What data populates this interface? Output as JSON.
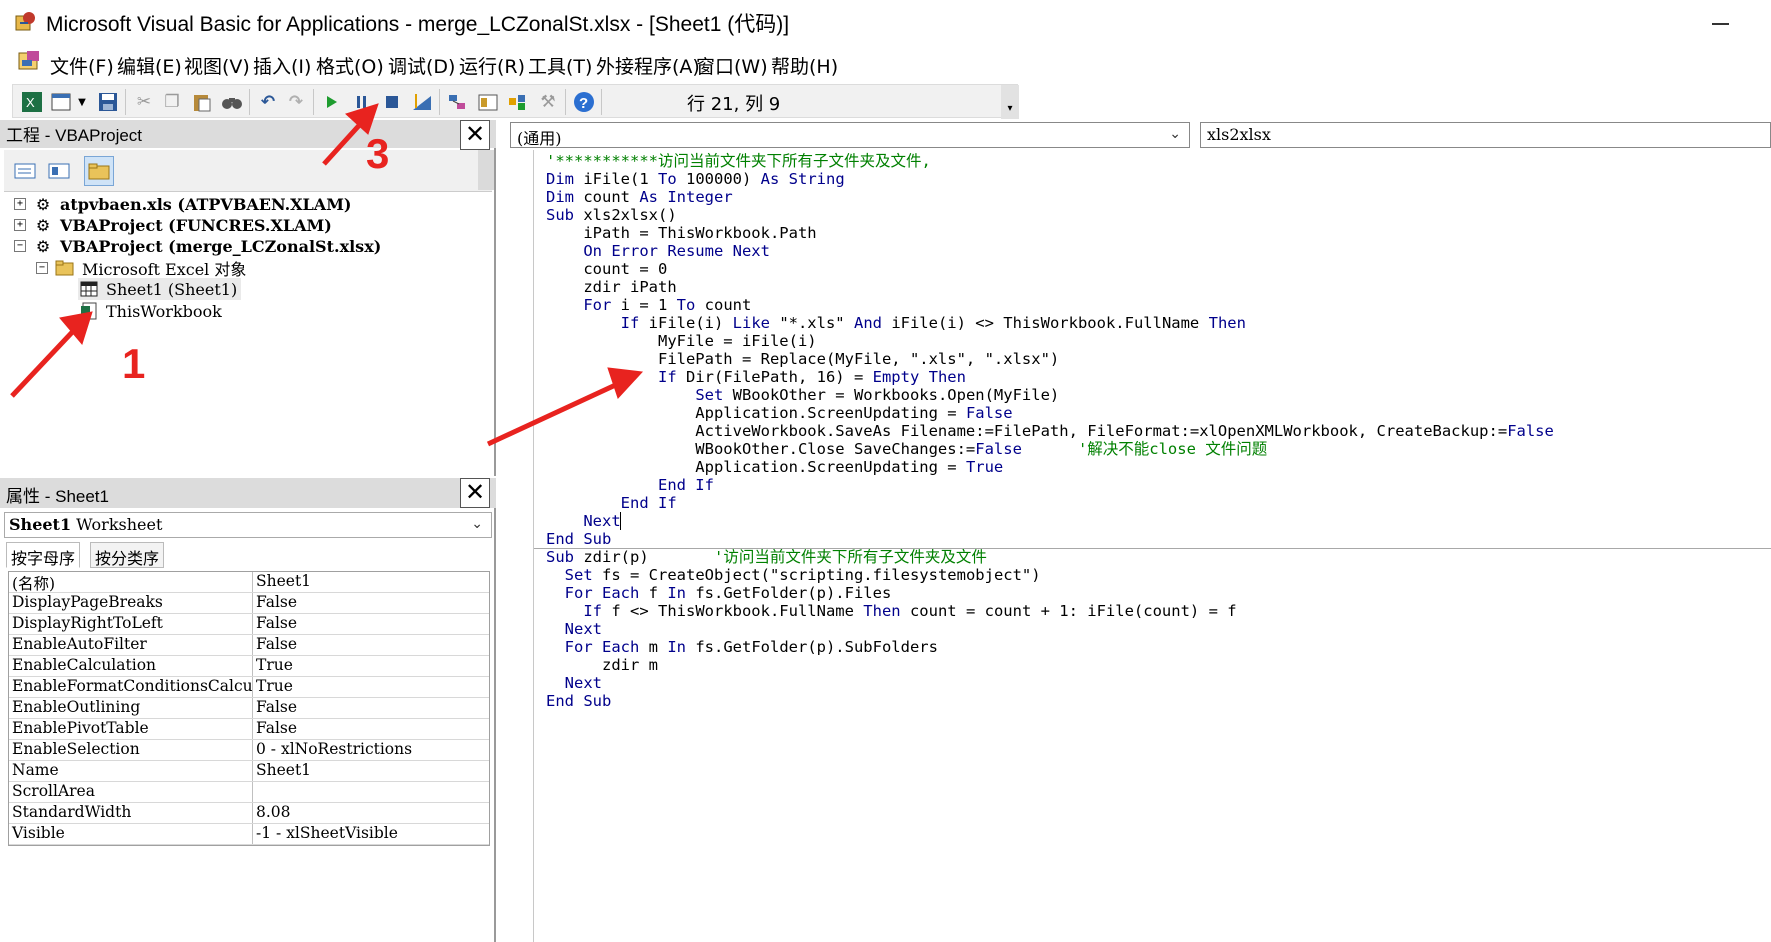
{
  "window": {
    "title": "Microsoft Visual Basic for Applications - merge_LCZonalSt.xlsx - [Sheet1 (代码)]"
  },
  "menu": [
    "文件(F)",
    "编辑(E)",
    "视图(V)",
    "插入(I)",
    "格式(O)",
    "调试(D)",
    "运行(R)",
    "工具(T)",
    "外接程序(A)",
    "窗口(W)",
    "帮助(H)"
  ],
  "toolbar": {
    "position_text": "行 21, 列 9"
  },
  "project": {
    "title": "工程 - VBAProject",
    "items": [
      {
        "label": "atpvbaen.xls (ATPVBAEN.XLAM)"
      },
      {
        "label": "VBAProject (FUNCRES.XLAM)"
      },
      {
        "label": "VBAProject (merge_LCZonalSt.xlsx)"
      },
      {
        "label": "Microsoft Excel 对象"
      },
      {
        "label": "Sheet1 (Sheet1)"
      },
      {
        "label": "ThisWorkbook"
      }
    ]
  },
  "properties": {
    "title": "属性 - Sheet1",
    "object_name": "Sheet1",
    "object_type": "Worksheet",
    "tabs": [
      "按字母序",
      "按分类序"
    ],
    "rows": [
      {
        "name": "(名称)",
        "value": "Sheet1"
      },
      {
        "name": "DisplayPageBreaks",
        "value": "False"
      },
      {
        "name": "DisplayRightToLeft",
        "value": "False"
      },
      {
        "name": "EnableAutoFilter",
        "value": "False"
      },
      {
        "name": "EnableCalculation",
        "value": "True"
      },
      {
        "name": "EnableFormatConditionsCalcu",
        "value": "True"
      },
      {
        "name": "EnableOutlining",
        "value": "False"
      },
      {
        "name": "EnablePivotTable",
        "value": "False"
      },
      {
        "name": "EnableSelection",
        "value": "0 - xlNoRestrictions"
      },
      {
        "name": "Name",
        "value": "Sheet1"
      },
      {
        "name": "ScrollArea",
        "value": ""
      },
      {
        "name": "StandardWidth",
        "value": "8.08"
      },
      {
        "name": "Visible",
        "value": "-1 - xlSheetVisible"
      }
    ]
  },
  "code": {
    "object_combo": "(通用)",
    "proc_combo": "xls2xlsx",
    "lines": [
      [
        {
          "t": "'***********访问当前文件夹下所有子文件夹及文件,",
          "c": "cm"
        }
      ],
      [
        {
          "t": "Dim",
          "c": "kw"
        },
        {
          "t": " iFile(1 "
        },
        {
          "t": "To",
          "c": "kw"
        },
        {
          "t": " 100000) "
        },
        {
          "t": "As String",
          "c": "kw"
        }
      ],
      [
        {
          "t": "Dim",
          "c": "kw"
        },
        {
          "t": " count "
        },
        {
          "t": "As Integer",
          "c": "kw"
        }
      ],
      [
        {
          "t": "Sub",
          "c": "kw"
        },
        {
          "t": " xls2xlsx()"
        }
      ],
      [
        {
          "t": "    iPath = ThisWorkbook.Path"
        }
      ],
      [
        {
          "t": "    "
        },
        {
          "t": "On Error Resume Next",
          "c": "kw"
        }
      ],
      [
        {
          "t": "    count = 0"
        }
      ],
      [
        {
          "t": "    zdir iPath"
        }
      ],
      [
        {
          "t": "    "
        },
        {
          "t": "For",
          "c": "kw"
        },
        {
          "t": " i = 1 "
        },
        {
          "t": "To",
          "c": "kw"
        },
        {
          "t": " count"
        }
      ],
      [
        {
          "t": "        "
        },
        {
          "t": "If",
          "c": "kw"
        },
        {
          "t": " iFile(i) "
        },
        {
          "t": "Like",
          "c": "kw"
        },
        {
          "t": " \"*.xls\" "
        },
        {
          "t": "And",
          "c": "kw"
        },
        {
          "t": " iFile(i) <> ThisWorkbook.FullName "
        },
        {
          "t": "Then",
          "c": "kw"
        }
      ],
      [
        {
          "t": "            MyFile = iFile(i)"
        }
      ],
      [
        {
          "t": "            FilePath = Replace(MyFile, \".xls\", \".xlsx\")"
        }
      ],
      [
        {
          "t": "            "
        },
        {
          "t": "If",
          "c": "kw"
        },
        {
          "t": " Dir(FilePath, 16) = "
        },
        {
          "t": "Empty Then",
          "c": "kw"
        }
      ],
      [
        {
          "t": "                "
        },
        {
          "t": "Set",
          "c": "kw"
        },
        {
          "t": " WBookOther = Workbooks.Open(MyFile)"
        }
      ],
      [
        {
          "t": "                Application.ScreenUpdating = "
        },
        {
          "t": "False",
          "c": "kw"
        }
      ],
      [
        {
          "t": "                ActiveWorkbook.SaveAs Filename:=FilePath, FileFormat:=xlOpenXMLWorkbook, CreateBackup:="
        },
        {
          "t": "False",
          "c": "kw"
        }
      ],
      [
        {
          "t": "                WBookOther.Close SaveChanges:="
        },
        {
          "t": "False",
          "c": "kw"
        },
        {
          "t": "      "
        },
        {
          "t": "'解决不能close 文件问题",
          "c": "cm"
        }
      ],
      [
        {
          "t": "                Application.ScreenUpdating = "
        },
        {
          "t": "True",
          "c": "kw"
        }
      ],
      [
        {
          "t": "            "
        },
        {
          "t": "End If",
          "c": "kw"
        }
      ],
      [
        {
          "t": "        "
        },
        {
          "t": "End If",
          "c": "kw"
        }
      ],
      [
        {
          "t": "    "
        },
        {
          "t": "Next",
          "c": "kw"
        }
      ],
      [
        {
          "t": "End Sub",
          "c": "kw"
        }
      ],
      [
        {
          "t": "Sub",
          "c": "kw"
        },
        {
          "t": " zdir(p)       "
        },
        {
          "t": "'访问当前文件夹下所有子文件夹及文件",
          "c": "cm"
        }
      ],
      [
        {
          "t": "  "
        },
        {
          "t": "Set",
          "c": "kw"
        },
        {
          "t": " fs = CreateObject(\"scripting.filesystemobject\")"
        }
      ],
      [
        {
          "t": "  "
        },
        {
          "t": "For Each",
          "c": "kw"
        },
        {
          "t": " f "
        },
        {
          "t": "In",
          "c": "kw"
        },
        {
          "t": " fs.GetFolder(p).Files"
        }
      ],
      [
        {
          "t": "    "
        },
        {
          "t": "If",
          "c": "kw"
        },
        {
          "t": " f <> ThisWorkbook.FullName "
        },
        {
          "t": "Then",
          "c": "kw"
        },
        {
          "t": " count = count + 1: iFile(count) = f"
        }
      ],
      [
        {
          "t": "  "
        },
        {
          "t": "Next",
          "c": "kw"
        }
      ],
      [
        {
          "t": "  "
        },
        {
          "t": "For Each",
          "c": "kw"
        },
        {
          "t": " m "
        },
        {
          "t": "In",
          "c": "kw"
        },
        {
          "t": " fs.GetFolder(p).SubFolders"
        }
      ],
      [
        {
          "t": "      zdir m"
        }
      ],
      [
        {
          "t": "  "
        },
        {
          "t": "Next",
          "c": "kw"
        }
      ],
      [
        {
          "t": "End Sub",
          "c": "kw"
        }
      ]
    ]
  },
  "annotations": {
    "label_1": "1",
    "label_3": "3",
    "color": "#e8231f"
  },
  "colors": {
    "keyword": "#00008b",
    "comment": "#008000"
  }
}
